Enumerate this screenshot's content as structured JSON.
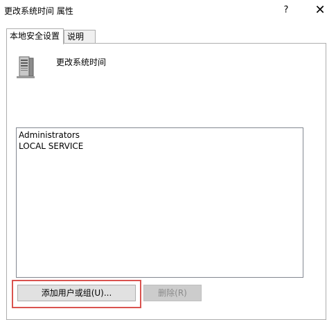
{
  "window": {
    "title": "更改系统时间 属性",
    "help_label": "?",
    "close_label": "✕"
  },
  "tabs": [
    {
      "label": "本地安全设置",
      "active": true
    },
    {
      "label": "说明",
      "active": false
    }
  ],
  "policy": {
    "name": "更改系统时间",
    "icon": "server-icon"
  },
  "members": [
    "Administrators",
    "LOCAL SERVICE"
  ],
  "buttons": {
    "add_label": "添加用户或组(U)...",
    "remove_label": "删除(R)"
  },
  "colors": {
    "highlight": "#d9534f",
    "disabled_text": "#8a8a8a"
  }
}
